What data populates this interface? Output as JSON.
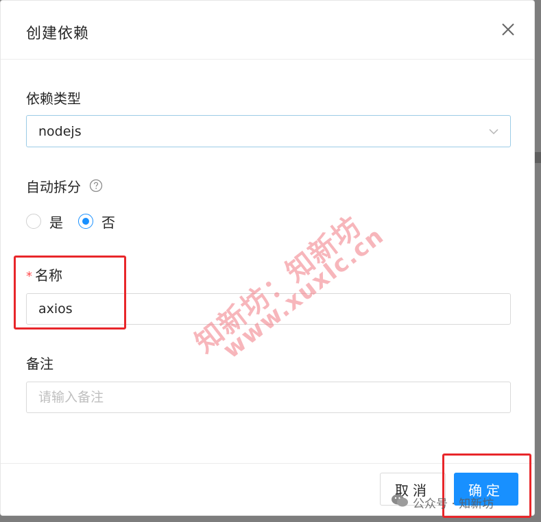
{
  "modal": {
    "title": "创建依赖",
    "close_icon": "close-icon"
  },
  "form": {
    "dep_type": {
      "label": "依赖类型",
      "value": "nodejs",
      "icon": "chevron-down-icon"
    },
    "auto_split": {
      "label": "自动拆分",
      "help_icon": "question-circle-icon",
      "options": [
        {
          "label": "是",
          "checked": false
        },
        {
          "label": "否",
          "checked": true
        }
      ]
    },
    "name": {
      "required_mark": "*",
      "label": "名称",
      "value": "axios"
    },
    "remark": {
      "label": "备注",
      "placeholder": "请输入备注"
    }
  },
  "footer": {
    "cancel_label": "取消",
    "ok_label": "确定"
  },
  "watermark": {
    "line1": "知新坊：知新坊",
    "line2": "www.xuxlc.cn"
  },
  "credit": {
    "text": "公众号 · 知新坊"
  },
  "colors": {
    "primary": "#1890ff",
    "highlight_box": "#e8262a",
    "required": "#ff4d4f"
  }
}
